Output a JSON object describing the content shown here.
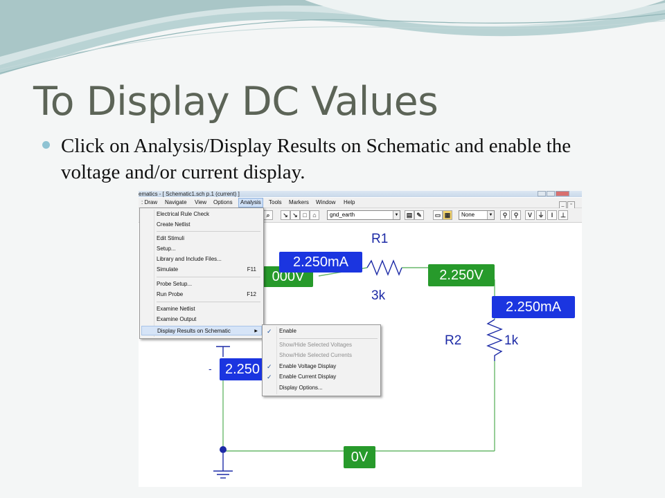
{
  "slide": {
    "title": "To Display DC Values",
    "bullet": "Click on Analysis/Display Results on Schematic and enable the voltage and/or current display."
  },
  "window": {
    "title": "ematics - [ Schematic1.sch  p.1 (current) ]"
  },
  "menubar": {
    "items": [
      ": Draw",
      "Navigate",
      "View",
      "Options",
      "Analysis",
      "Tools",
      "Markers",
      "Window",
      "Help"
    ],
    "active": "Analysis"
  },
  "toolbar": {
    "part_combo": "gnd_earth",
    "zoom_combo": "None",
    "display_buttons": [
      "V",
      "I"
    ]
  },
  "analysis_menu": {
    "items": [
      {
        "label": "Electrical Rule Check",
        "shortcut": ""
      },
      {
        "label": "Create Netlist",
        "shortcut": ""
      },
      {
        "label": "Edit Stimuli",
        "shortcut": ""
      },
      {
        "label": "Setup...",
        "shortcut": ""
      },
      {
        "label": "Library and Include Files...",
        "shortcut": ""
      },
      {
        "label": "Simulate",
        "shortcut": "F11"
      },
      {
        "label": "Probe Setup...",
        "shortcut": ""
      },
      {
        "label": "Run Probe",
        "shortcut": "F12"
      },
      {
        "label": "Examine Netlist",
        "shortcut": ""
      },
      {
        "label": "Examine Output",
        "shortcut": ""
      },
      {
        "label": "Display Results on Schematic",
        "shortcut": ""
      }
    ]
  },
  "display_submenu": {
    "items": [
      {
        "label": "Enable",
        "checked": true,
        "disabled": false
      },
      {
        "label": "Show/Hide Selected Voltages",
        "checked": false,
        "disabled": true
      },
      {
        "label": "Show/Hide Selected Currents",
        "checked": false,
        "disabled": true
      },
      {
        "label": "Enable Voltage Display",
        "checked": true,
        "disabled": false
      },
      {
        "label": "Enable Current Display",
        "checked": true,
        "disabled": false
      },
      {
        "label": "Display Options...",
        "checked": false,
        "disabled": false
      }
    ]
  },
  "schematic": {
    "components": {
      "r1_name": "R1",
      "r1_value": "3k",
      "r2_name": "R2",
      "r2_value": "1k"
    },
    "labels": {
      "r1_current": "2.250mA",
      "left_node_voltage": "000V",
      "mid_node_voltage": "2.250V",
      "r2_current": "2.250mA",
      "source_current": "2.250",
      "ground_voltage": "0V",
      "minus_sign": "-"
    },
    "colors": {
      "voltage_label": "#279a2b",
      "current_label": "#1b35e0",
      "wire": "#69b86b",
      "part": "#1c2aa6"
    }
  },
  "icons": [
    "window-buttons",
    "toolbar-icons",
    "checkmark-icon",
    "submenu-arrow-icon",
    "resistor-symbol",
    "ground-symbol",
    "junction-dot"
  ]
}
